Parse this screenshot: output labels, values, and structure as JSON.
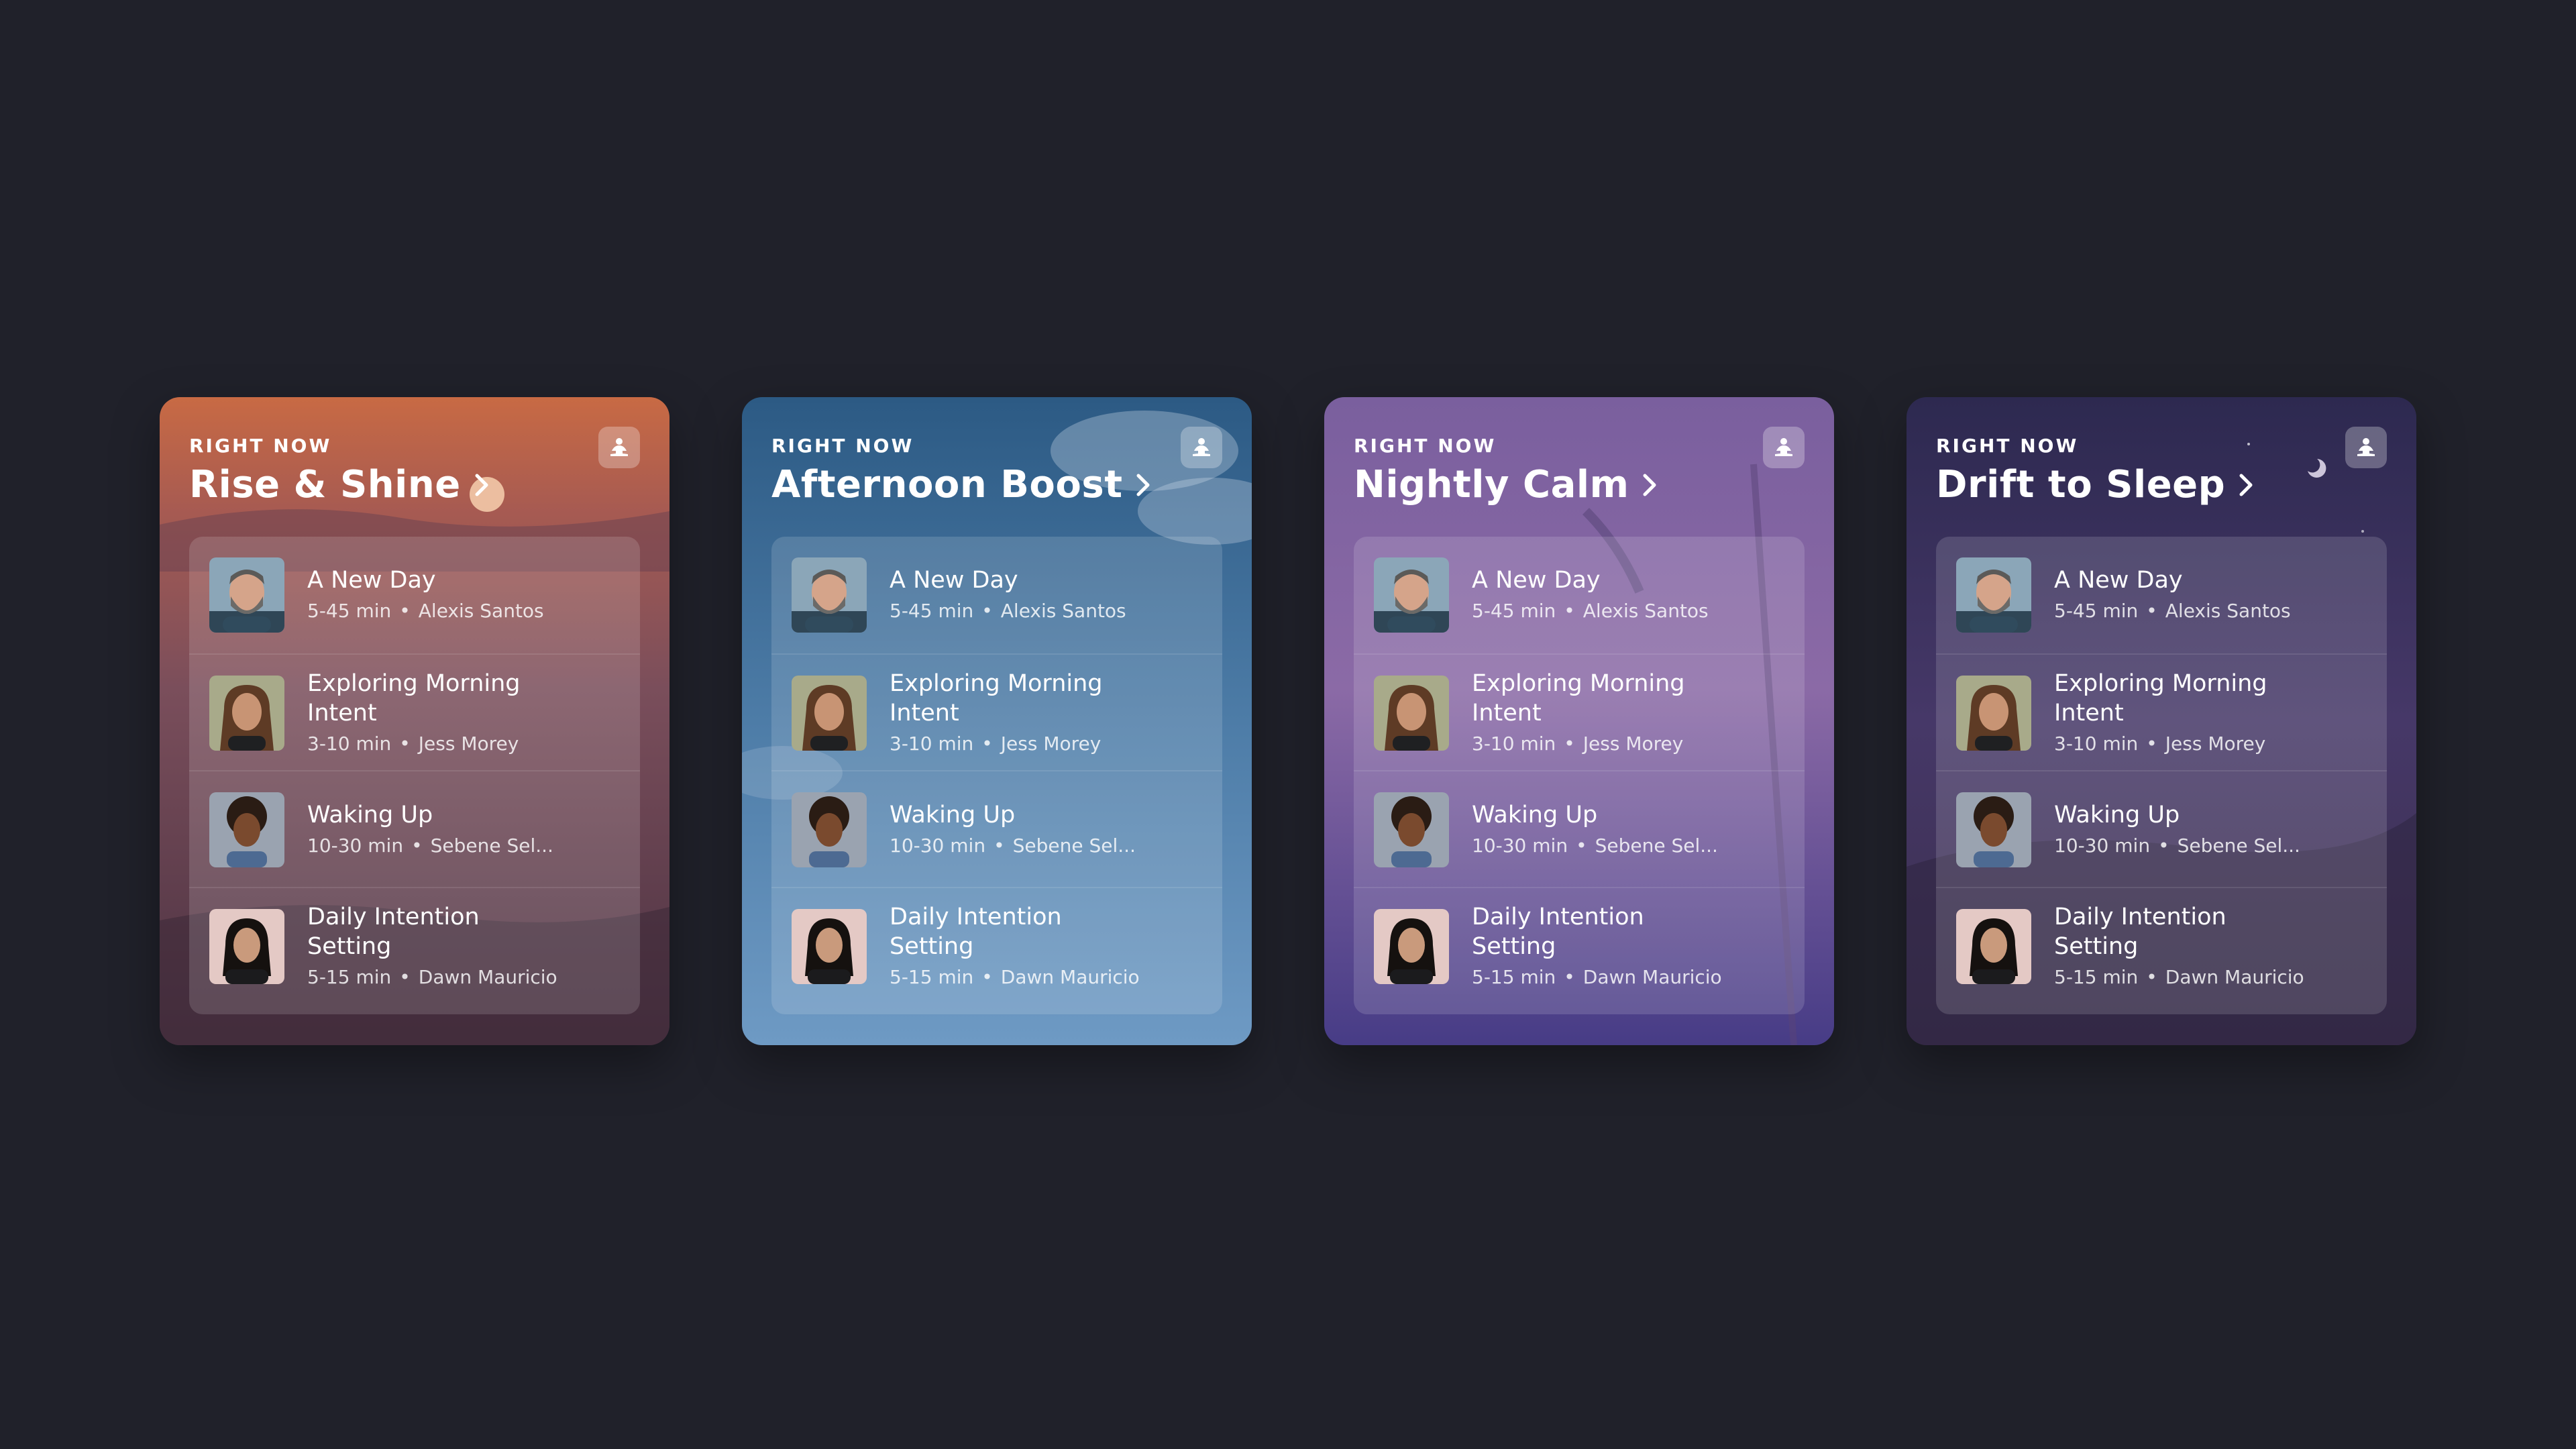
{
  "eyebrow": "RIGHT NOW",
  "cards": [
    {
      "id": "rise",
      "title": "Rise & Shine",
      "colors": {
        "top": "#c96a45",
        "mid": "#7a4f5a",
        "bottom": "#4a3444"
      }
    },
    {
      "id": "afternoon",
      "title": "Afternoon Boost",
      "colors": {
        "top": "#2f5d86",
        "mid": "#4f7ea8",
        "bottom": "#6f9bc5"
      }
    },
    {
      "id": "nightly",
      "title": "Nightly Calm",
      "colors": {
        "top": "#7a5d9a",
        "mid": "#8a6aa8",
        "bottom": "#4a3e86"
      }
    },
    {
      "id": "drift",
      "title": "Drift to Sleep",
      "colors": {
        "top": "#2f2a54",
        "mid": "#4a3a6a",
        "bottom": "#3a2f4e"
      }
    }
  ],
  "sessions": [
    {
      "name": "A New Day",
      "duration": "5-45 min",
      "teacher": "Alexis Santos",
      "avatar": "man-gray-beard-avatar"
    },
    {
      "name": "Exploring Morning Intent",
      "duration": "3-10 min",
      "teacher": "Jess Morey",
      "avatar": "woman-brown-hair-avatar"
    },
    {
      "name": "Waking Up",
      "duration": "10-30 min",
      "teacher": "Sebene Sel...",
      "avatar": "woman-curly-hair-avatar"
    },
    {
      "name": "Daily Intention Setting",
      "duration": "5-15 min",
      "teacher": "Dawn Mauricio",
      "avatar": "woman-black-hair-avatar"
    }
  ],
  "separator": "•",
  "icons": {
    "badge": "meditation-icon",
    "chevron": "chevron-right-icon"
  }
}
